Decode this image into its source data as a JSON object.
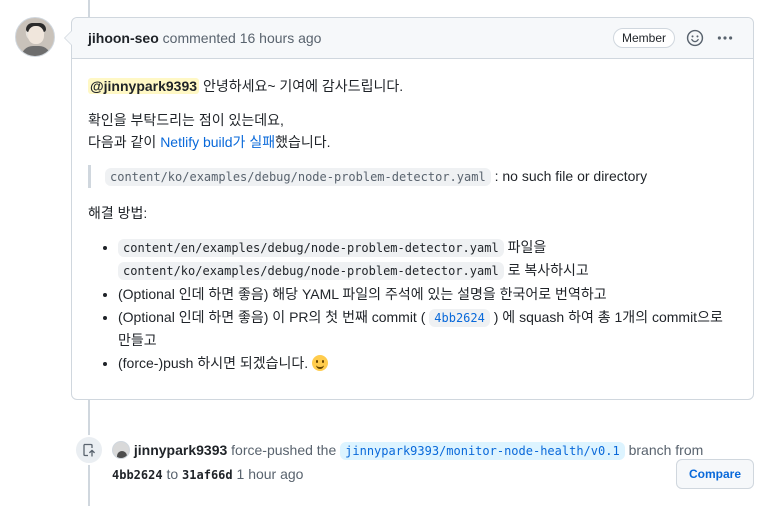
{
  "comment": {
    "author": "jihoon-seo",
    "action": "commented",
    "time": "16 hours ago",
    "badge": "Member",
    "mention": "@jinnypark9393",
    "greeting": "안녕하세요~ 기여에 감사드립니다.",
    "line2a": "확인을 부탁드리는 점이 있는데요,",
    "line2b_pre": "다음과 같이",
    "line2b_link": "Netlify build가 실패",
    "line2b_post": "했습니다.",
    "quote_code": "content/ko/examples/debug/node-problem-detector.yaml",
    "quote_text": ": no such file or directory",
    "solution_title": "해결 방법:",
    "item1_code1": "content/en/examples/debug/node-problem-detector.yaml",
    "item1_text1": "파일을",
    "item1_code2": "content/ko/examples/debug/node-problem-detector.yaml",
    "item1_text2": "로 복사하시고",
    "item2": "(Optional 인데 하면 좋음) 해당 YAML 파일의 주석에 있는 설명을 한국어로 번역하고",
    "item3_pre": "(Optional 인데 하면 좋음) 이 PR의 첫 번째 commit (",
    "item3_sha": "4bb2624",
    "item3_post": ") 에 squash 하여 총 1개의 commit으로 만들고",
    "item4": "(force-)push 하시면 되겠습니다."
  },
  "event": {
    "actor": "jinnypark9393",
    "action": "force-pushed the",
    "branch": "jinnypark9393/monitor-node-health/v0.1",
    "branch_suffix": "branch from",
    "from_sha": "4bb2624",
    "to": "to",
    "to_sha": "31af66d",
    "time": "1 hour ago",
    "compare_label": "Compare"
  }
}
